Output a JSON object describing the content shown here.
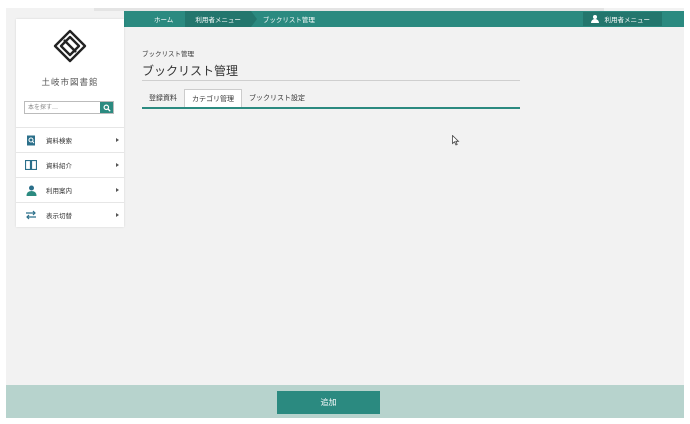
{
  "nav": {
    "breadcrumbs": [
      "ホーム",
      "利用者メニュー",
      "ブックリスト管理"
    ],
    "user_menu": "利用者メニュー"
  },
  "sidebar": {
    "library_name": "土岐市図書館",
    "search_placeholder": "本を探す…",
    "items": [
      {
        "label": "資料検索",
        "icon": "book-search-icon"
      },
      {
        "label": "資料紹介",
        "icon": "open-book-icon"
      },
      {
        "label": "利用案内",
        "icon": "person-icon"
      },
      {
        "label": "表示切替",
        "icon": "switch-arrows-icon"
      }
    ]
  },
  "main": {
    "breadcrumb": "ブックリスト管理",
    "title": "ブックリスト管理",
    "tabs": [
      {
        "label": "登録資料",
        "active": false
      },
      {
        "label": "カテゴリ管理",
        "active": true
      },
      {
        "label": "ブックリスト設定",
        "active": false
      }
    ]
  },
  "footer": {
    "add_label": "追加"
  },
  "colors": {
    "accent": "#2b8a80",
    "accent_dark": "#23766d",
    "footer_bg": "#b7d3cd",
    "page_bg": "#f2f2f2"
  }
}
